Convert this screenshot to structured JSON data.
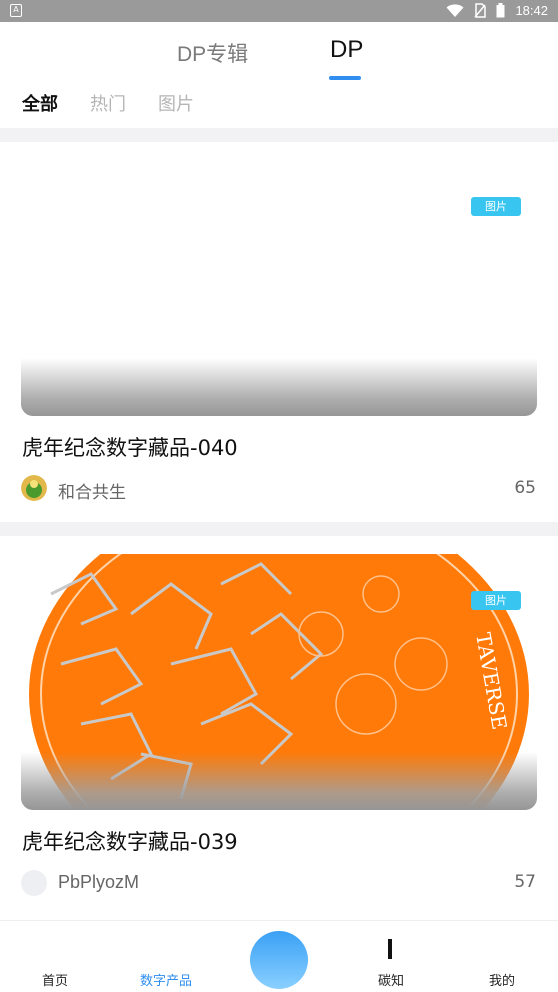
{
  "status_bar": {
    "time": "18:42"
  },
  "top_tabs": [
    {
      "label": "DP专辑",
      "active": false
    },
    {
      "label": "DP",
      "active": true
    }
  ],
  "category_tabs": [
    {
      "label": "全部",
      "active": true
    },
    {
      "label": "热门",
      "active": false
    },
    {
      "label": "图片",
      "active": false
    }
  ],
  "cards": [
    {
      "badge": "图片",
      "title": "虎年纪念数字藏品-040",
      "author": "和合共生",
      "count": "65"
    },
    {
      "badge": "图片",
      "title": "虎年纪念数字藏品-039",
      "author": "PbPlyozM",
      "count": "57",
      "image_text": "TAVERSE"
    }
  ],
  "bottom_nav": [
    {
      "label": "首页",
      "active": false
    },
    {
      "label": "数字产品",
      "active": true
    },
    {
      "label": "碳知",
      "active": false
    },
    {
      "label": "我的",
      "active": false
    }
  ],
  "colors": {
    "accent": "#2f8ef0",
    "badge": "#38c6f0",
    "coin_orange": "#ff7a08"
  }
}
